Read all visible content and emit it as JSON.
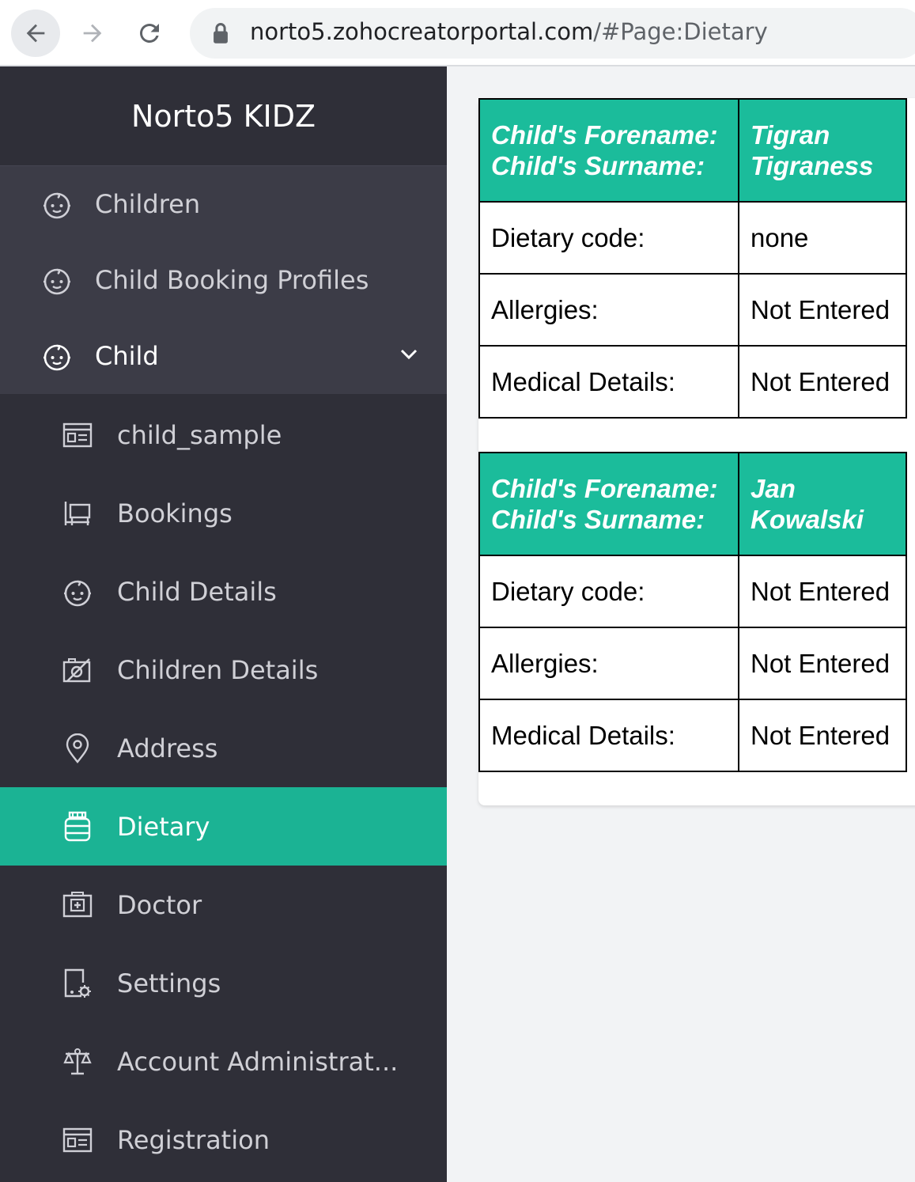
{
  "browser": {
    "url_host": "norto5.zohocreatorportal.com",
    "url_path": "/#Page:Dietary"
  },
  "sidebar": {
    "brand": "Norto5 KIDZ",
    "top_items": [
      {
        "label": "Children",
        "icon": "child-face-icon"
      },
      {
        "label": "Child Booking Profiles",
        "icon": "child-face-icon"
      }
    ],
    "child_group": {
      "label": "Child",
      "icon": "child-face-icon",
      "expanded": true
    },
    "sub_items": [
      {
        "label": "child_sample",
        "icon": "form-icon"
      },
      {
        "label": "Bookings",
        "icon": "desk-icon"
      },
      {
        "label": "Child Details",
        "icon": "child-face-icon"
      },
      {
        "label": "Children Details",
        "icon": "image-slash-icon"
      },
      {
        "label": "Address",
        "icon": "map-pin-icon"
      },
      {
        "label": "Dietary",
        "icon": "jar-icon",
        "active": true
      },
      {
        "label": "Doctor",
        "icon": "medical-kit-icon"
      },
      {
        "label": "Settings",
        "icon": "settings-page-icon"
      },
      {
        "label": "Account Administrat...",
        "icon": "scales-icon"
      },
      {
        "label": "Registration",
        "icon": "form-icon"
      }
    ]
  },
  "records": [
    {
      "header_label": "Child's Forename:\nChild's Surname:",
      "forename": "Tigran",
      "surname": "Tigraness",
      "rows": [
        {
          "label": "Dietary code:",
          "value": "none"
        },
        {
          "label": "Allergies:",
          "value": "Not Entered"
        },
        {
          "label": "Medical Details:",
          "value": "Not Entered"
        }
      ]
    },
    {
      "header_label": "Child's Forename:\nChild's Surname:",
      "forename": "Jan",
      "surname": "Kowalski",
      "rows": [
        {
          "label": "Dietary code:",
          "value": "Not Entered"
        },
        {
          "label": "Allergies:",
          "value": "Not Entered"
        },
        {
          "label": "Medical Details:",
          "value": "Not Entered"
        }
      ]
    }
  ],
  "colors": {
    "accent": "#1bb394",
    "sidebar_bg": "#2f2f38",
    "sidebar_group_bg": "#3c3c47",
    "table_header_bg": "#1bbc9b"
  }
}
